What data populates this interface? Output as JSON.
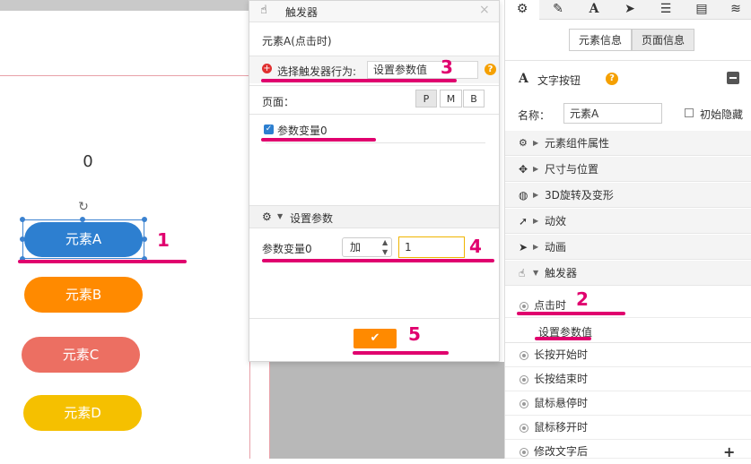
{
  "canvas": {
    "counter_value": "0",
    "elements": [
      "元素A",
      "元素B",
      "元素C",
      "元素D"
    ],
    "colors": {
      "a": "#2d7fd0",
      "b": "#ff8a00",
      "c": "#ec6f62",
      "d": "#f5c000"
    }
  },
  "dialog": {
    "title": "触发器",
    "subtitle": "元素A(点击时)",
    "behavior_label": "选择触发器行为:",
    "behavior_value": "设置参数值",
    "page_label": "页面：",
    "page_buttons": [
      "P",
      "M",
      "B"
    ],
    "variable_checkbox": "参数变量0",
    "set_param_header": "设置参数",
    "param_name": "参数变量0",
    "operation": "加",
    "param_input_value": "1"
  },
  "panel": {
    "tabs": [
      "gear-icon",
      "pencil-icon",
      "text-a-icon",
      "send-icon",
      "list-icon",
      "document-icon",
      "database-icon"
    ],
    "info_tabs": [
      "元素信息",
      "页面信息"
    ],
    "component_title": "文字按钮",
    "name_label": "名称：",
    "name_value": "元素A",
    "hidden_label": "初始隐藏",
    "sections": [
      "元素组件属性",
      "尺寸与位置",
      "3D旋转及变形",
      "动效",
      "动画",
      "触发器"
    ],
    "events": [
      "点击时",
      "长按开始时",
      "长按结束时",
      "鼠标悬停时",
      "鼠标移开时",
      "修改文字后"
    ],
    "event_action": "设置参数值",
    "add_symbol": "+"
  },
  "annotations": [
    "1",
    "2",
    "3",
    "4",
    "5"
  ],
  "accent_color": "#e0006e"
}
